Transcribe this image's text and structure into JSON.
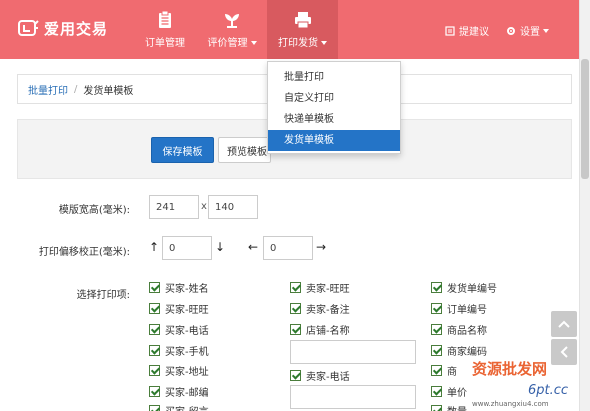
{
  "brand": {
    "name": "爱用交易"
  },
  "nav": {
    "items": [
      {
        "label": "订单管理",
        "icon": "clipboard-icon"
      },
      {
        "label": "评价管理",
        "icon": "flower-icon"
      },
      {
        "label": "打印发货",
        "icon": "printer-icon"
      }
    ],
    "suggest": "提建议",
    "settings": "设置"
  },
  "dropdown": {
    "items": [
      "批量打印",
      "自定义打印",
      "快递单模板",
      "发货单模板"
    ],
    "active_index": 3
  },
  "breadcrumb": {
    "link": "批量打印",
    "separator": "/",
    "current": "发货单模板"
  },
  "toolbar": {
    "save_label": "保存模板",
    "preview_label": "预览模板"
  },
  "form": {
    "size_label": "模版宽高(毫米):",
    "width": "241",
    "times": "x",
    "height": "140",
    "offset_label": "打印偏移校正(毫米):",
    "offset_v": "0",
    "offset_h": "0",
    "fields_label": "选择打印项:"
  },
  "fields": {
    "col1": [
      "买家-姓名",
      "买家-旺旺",
      "买家-电话",
      "买家-手机",
      "买家-地址",
      "买家-邮编",
      "买家-留言"
    ],
    "col2": [
      "卖家-旺旺",
      "卖家-备注",
      "店铺-名称",
      "卖家-电话"
    ],
    "col3": [
      "发货单编号",
      "订单编号",
      "商品名称",
      "商家编码",
      "商",
      "单价",
      "数量"
    ]
  },
  "watermark": {
    "text": "资源批发网",
    "site": "www.zhuangxiu4.com"
  },
  "colors": {
    "header": "#f06b70",
    "active": "#2474c7"
  }
}
